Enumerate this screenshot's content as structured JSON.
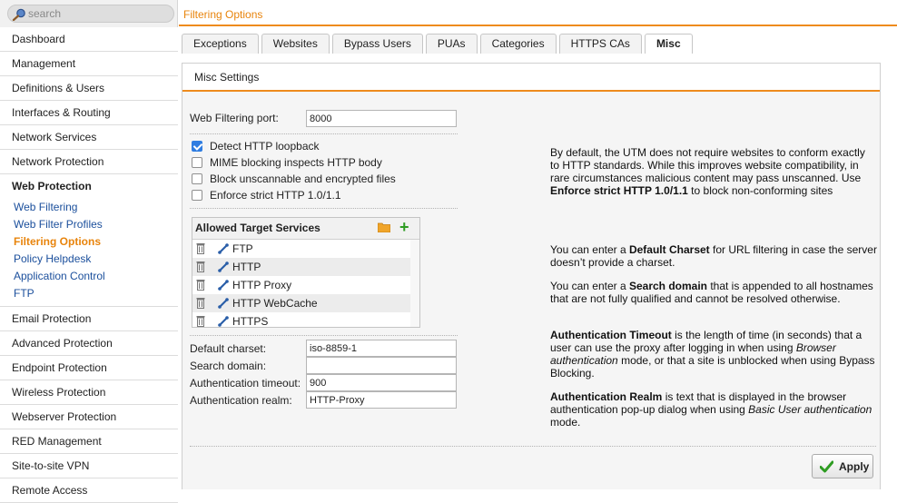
{
  "search": {
    "placeholder": "search"
  },
  "sidebar": {
    "items_top": [
      "Dashboard",
      "Management",
      "Definitions & Users",
      "Interfaces & Routing",
      "Network Services",
      "Network Protection"
    ],
    "group": {
      "label": "Web Protection",
      "items": [
        "Web Filtering",
        "Web Filter Profiles",
        "Filtering Options",
        "Policy Helpdesk",
        "Application Control",
        "FTP"
      ],
      "active_index": 2
    },
    "items_bottom": [
      "Email Protection",
      "Advanced Protection",
      "Endpoint Protection",
      "Wireless Protection",
      "Webserver Protection",
      "RED Management",
      "Site-to-site VPN",
      "Remote Access"
    ]
  },
  "header": {
    "title": "Filtering Options"
  },
  "tabs": [
    {
      "label": "Exceptions"
    },
    {
      "label": "Websites"
    },
    {
      "label": "Bypass Users"
    },
    {
      "label": "PUAs"
    },
    {
      "label": "Categories"
    },
    {
      "label": "HTTPS CAs"
    },
    {
      "label": "Misc",
      "active": true
    }
  ],
  "panel": {
    "title": "Misc Settings",
    "port": {
      "label": "Web Filtering port:",
      "value": "8000"
    },
    "checkboxes": [
      {
        "label": "Detect HTTP loopback",
        "checked": true
      },
      {
        "label": "MIME blocking inspects HTTP body",
        "checked": false
      },
      {
        "label": "Block unscannable and encrypted files",
        "checked": false
      },
      {
        "label": "Enforce strict HTTP 1.0/1.1",
        "checked": false
      }
    ],
    "services": {
      "title": "Allowed Target Services",
      "items": [
        "FTP",
        "HTTP",
        "HTTP Proxy",
        "HTTP WebCache",
        "HTTPS"
      ]
    },
    "fields": {
      "charset": {
        "label": "Default charset:",
        "value": "iso-8859-1"
      },
      "domain": {
        "label": "Search domain:",
        "value": ""
      },
      "timeout": {
        "label": "Authentication timeout:",
        "value": "900"
      },
      "realm": {
        "label": "Authentication realm:",
        "value": "HTTP-Proxy"
      }
    },
    "help": {
      "strict_pre": "By default, the UTM does not require websites to conform exactly to HTTP standards. While this improves website compatibility, in rare circumstances malicious content may pass unscanned. Use ",
      "strict_bold": "Enforce strict HTTP 1.0/1.1",
      "strict_post": " to block non-conforming sites",
      "charset_pre": "You can enter a ",
      "charset_bold": "Default Charset",
      "charset_post": " for URL filtering in case the server doesn’t provide a charset.",
      "domain_pre": "You can enter a ",
      "domain_bold": "Search domain",
      "domain_post": " that is appended to all hostnames that are not fully qualified and cannot be resolved otherwise.",
      "timeout_bold": "Authentication Timeout",
      "timeout_mid": " is the length of time (in seconds) that a user can use the proxy after logging in when using ",
      "timeout_italic": "Browser authentication",
      "timeout_post": " mode, or that a site is unblocked when using Bypass Blocking.",
      "realm_bold": "Authentication Realm",
      "realm_mid": " is text that is displayed in the browser authentication pop-up dialog when using ",
      "realm_italic": "Basic User authentication",
      "realm_post": " mode."
    },
    "apply_label": "Apply"
  },
  "colors": {
    "accent": "#ee8b1d",
    "link": "#1b4f9c",
    "active_link": "#e8840c",
    "add": "#2e9c22"
  }
}
